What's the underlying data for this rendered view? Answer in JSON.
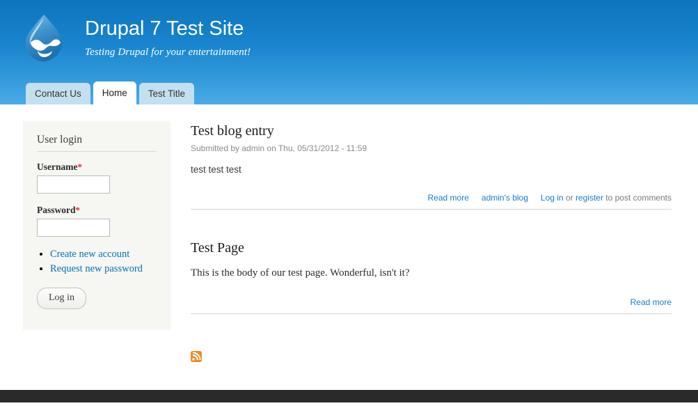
{
  "header": {
    "logo_icon": "drupal-droplet-logo",
    "site_name": "Drupal 7 Test Site",
    "site_slogan": "Testing Drupal for your entertainment!",
    "gradient_top": "#0b74bd",
    "gradient_bottom": "#49aae6"
  },
  "tabs": [
    {
      "label": "Contact Us",
      "active": false
    },
    {
      "label": "Home",
      "active": true
    },
    {
      "label": "Test Title",
      "active": false
    }
  ],
  "sidebar": {
    "block_title": "User login",
    "username": {
      "label": "Username",
      "required_marker": "*",
      "value": "",
      "placeholder": ""
    },
    "password": {
      "label": "Password",
      "required_marker": "*",
      "value": "",
      "placeholder": ""
    },
    "links": [
      {
        "label": "Create new account"
      },
      {
        "label": "Request new password"
      }
    ],
    "submit_label": "Log in",
    "background": "#f6f6f2",
    "link_color": "#0073b6"
  },
  "main": {
    "nodes": [
      {
        "title": "Test blog entry",
        "submitted": "Submitted by admin on Thu, 05/31/2012 - 11:59",
        "body": "test test test",
        "links": {
          "read_more": "Read more",
          "blog_link": "admin's blog",
          "login": "Log in",
          "or": " or ",
          "register": "register",
          "suffix": " to post comments"
        }
      },
      {
        "title": "Test Page",
        "body": "This is the body of our test page. Wonderful, isn't it?",
        "links": {
          "read_more": "Read more"
        }
      }
    ],
    "feed_icon": "rss-feed-icon",
    "link_color": "#1a7bc9"
  },
  "footer": {
    "background": "#2a2a2a"
  }
}
